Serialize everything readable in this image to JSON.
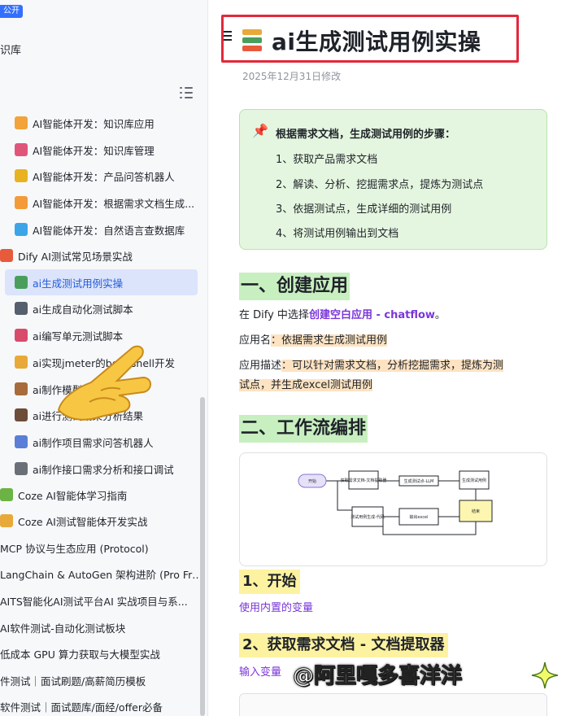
{
  "sidebar": {
    "badge": "公开",
    "kb_name": "识库",
    "items": [
      {
        "label": "AI智能体开发：知识库应用",
        "icon": "gift-icon",
        "color": "#f2a33a"
      },
      {
        "label": "AI智能体开发：知识库管理",
        "icon": "bow-icon",
        "color": "#e0567a"
      },
      {
        "label": "AI智能体开发：产品问答机器人",
        "icon": "fruit-icon",
        "color": "#e8b321"
      },
      {
        "label": "AI智能体开发：根据需求文档生成...",
        "icon": "card-icon",
        "color": "#f29b38"
      },
      {
        "label": "AI智能体开发：自然语言查数据库",
        "icon": "screen-icon",
        "color": "#3ba5e8"
      },
      {
        "label": "Dify AI测试常见场景实战",
        "icon": "tomato-icon",
        "color": "#e85a3c"
      },
      {
        "label": "ai生成测试用例实操",
        "icon": "books-icon",
        "color": "#4a9e5c",
        "active": true
      },
      {
        "label": "ai生成自动化测试脚本",
        "icon": "mask-icon",
        "color": "#555f6d"
      },
      {
        "label": "ai编写单元测试脚本",
        "icon": "shirt-icon",
        "color": "#d94b6b"
      },
      {
        "label": "ai实现jmeter的beanshell开发",
        "icon": "palette-icon",
        "color": "#e8a93a"
      },
      {
        "label": "ai制作模型测试集",
        "icon": "person-icon",
        "color": "#a86b3c"
      },
      {
        "label": "ai进行测试结果分析结果",
        "icon": "gear-icon",
        "color": "#6d4c3a"
      },
      {
        "label": "ai制作项目需求问答机器人",
        "icon": "chart-icon",
        "color": "#5b7fd6"
      },
      {
        "label": "ai制作接口需求分析和接口调试",
        "icon": "house-icon",
        "color": "#6b6f78"
      },
      {
        "label": "Coze AI智能体学习指南",
        "icon": "turtle-icon",
        "color": "#6bb344"
      },
      {
        "label": "Coze AI测试智能体开发实战",
        "icon": "hat-icon",
        "color": "#e8a93a"
      },
      {
        "label": "MCP 协议与生态应用 (Protocol)",
        "icon": "",
        "color": ""
      },
      {
        "label": "LangChain & AutoGen 架构进阶 (Pro Fra...",
        "icon": "",
        "color": ""
      },
      {
        "label": "AITS智能化AI测试平台AI 实战项目与系...",
        "icon": "",
        "color": ""
      },
      {
        "label": "AI软件测试-自动化测试板块",
        "icon": "",
        "color": ""
      },
      {
        "label": "低成本 GPU 算力获取与大模型实战",
        "icon": "",
        "color": ""
      },
      {
        "label": "件测试｜面试刷题/高薪简历模板",
        "icon": "",
        "color": ""
      },
      {
        "label": "软件测试｜面试题库/面经/offer必备",
        "icon": "",
        "color": ""
      }
    ]
  },
  "doc": {
    "title": "ai生成测试用例实操",
    "modified": "2025年12月31日修改",
    "callout": {
      "title": "根据需求文档，生成测试用例的步骤：",
      "steps": [
        "1、获取产品需求文档",
        "2、解读、分析、挖掘需求点，提炼为测试点",
        "3、依据测试点，生成详细的测试用例",
        "4、将测试用例输出到文档"
      ]
    },
    "section1": {
      "heading": "一、创建应用",
      "line1_prefix": "在 Dify 中选择",
      "line1_link": "创建空白应用 - chatflow",
      "line1_suffix": "。",
      "name_label": "应用名",
      "name_value": "：依据需求生成测试用例",
      "desc_label": "应用描述",
      "desc_value_1": "：可以针对需求文档，分析挖掘需求，提炼为测",
      "desc_value_2": "试点，并生成excel测试用例"
    },
    "section2": {
      "heading": "二、工作流编排",
      "nodes": [
        "开始",
        "获取需求文档-文档提取器",
        "生成测试点-LLM",
        "生成测试用例",
        "测试用例生成-代码",
        "输出excel",
        "结束"
      ]
    },
    "step1": {
      "heading": "1、开始",
      "text": "使用内置的变量"
    },
    "step2": {
      "heading": "2、获取需求文档 - 文档提取器",
      "text": "输入变量"
    }
  },
  "watermark": "@阿里嘎多喜洋洋",
  "colors": {
    "accent": "#245bdb",
    "title_border": "#e3283b",
    "callout_bg": "#e4f6df",
    "heading_bg": "#c8efc0",
    "subheading_bg": "#fdf2a0",
    "link": "#7a36d9"
  }
}
